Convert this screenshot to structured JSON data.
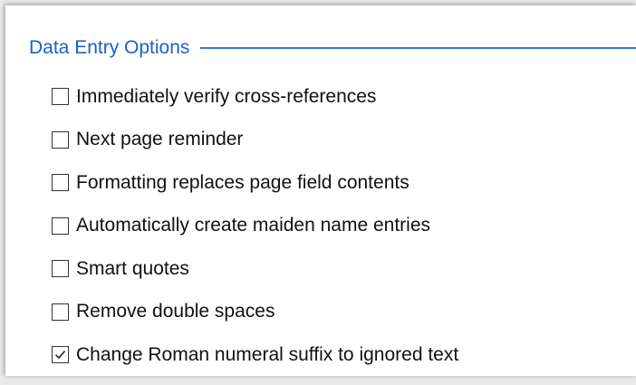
{
  "group": {
    "title": "Data Entry Options"
  },
  "options": [
    {
      "label": "Immediately verify cross-references",
      "checked": false
    },
    {
      "label": "Next page reminder",
      "checked": false
    },
    {
      "label": "Formatting replaces page field contents",
      "checked": false
    },
    {
      "label": "Automatically create maiden name entries",
      "checked": false
    },
    {
      "label": "Smart quotes",
      "checked": false
    },
    {
      "label": "Remove double spaces",
      "checked": false
    },
    {
      "label": "Change Roman numeral suffix to ignored text",
      "checked": true
    }
  ],
  "colors": {
    "title": "#1b5fc9",
    "rule": "#2f7bd8"
  }
}
